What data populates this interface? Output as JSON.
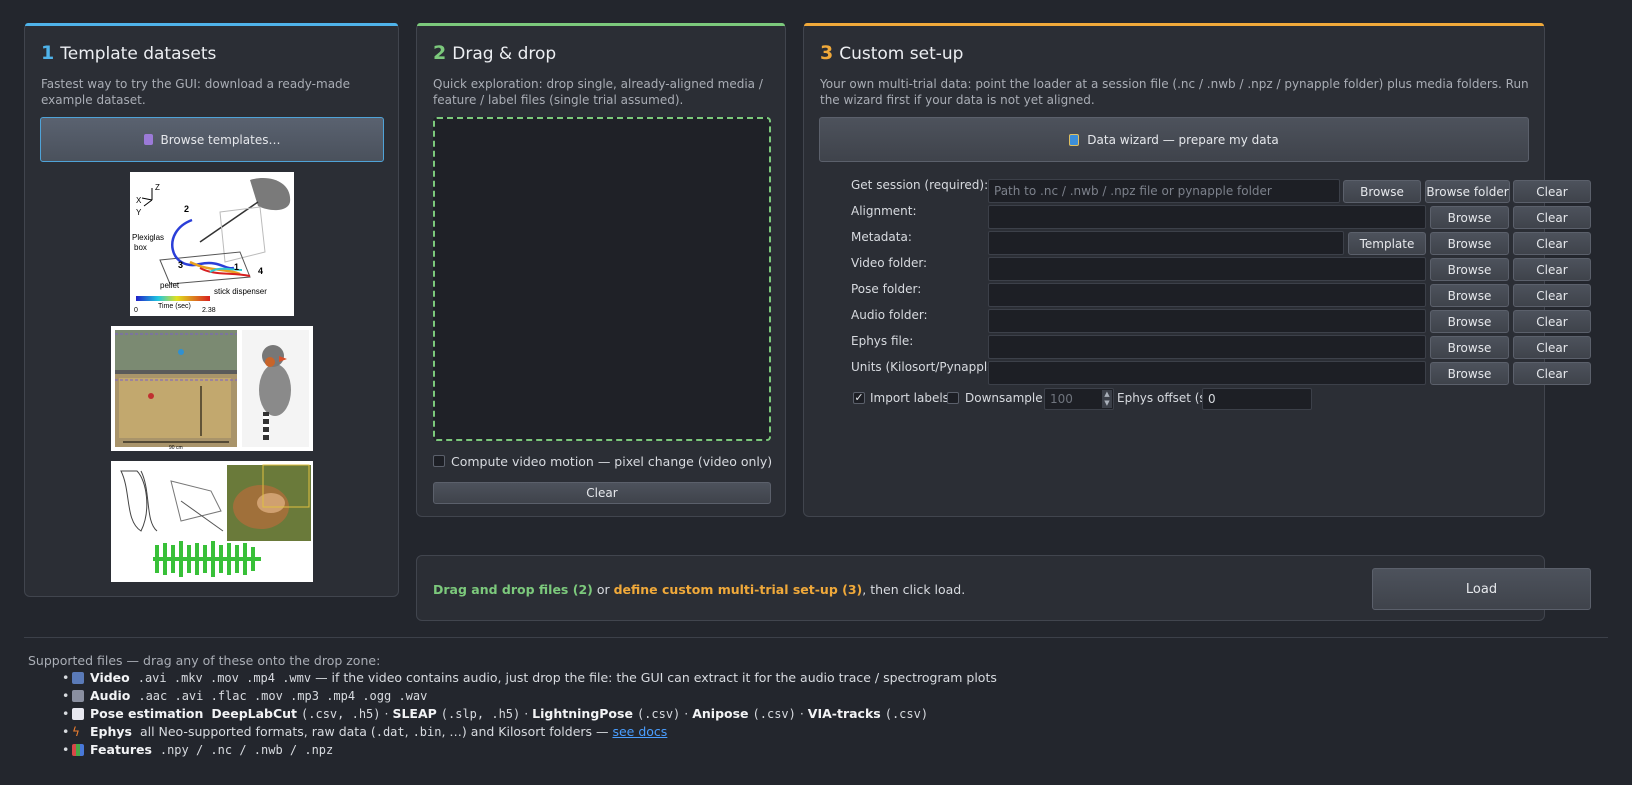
{
  "panel1": {
    "num": "1",
    "title": "Template datasets",
    "desc": "Fastest way to try the GUI: download a ready-made example dataset.",
    "browse_label": "Browse templates…",
    "thumb1": {
      "labels": [
        "Z",
        "X",
        "Y",
        "2",
        "Plexiglas",
        "box",
        "3",
        "1",
        "4",
        "pellet",
        "stick dispenser",
        "0",
        "Time (sec)",
        "2.38"
      ]
    },
    "thumb2": {
      "labels": [
        "90 cm"
      ]
    }
  },
  "panel2": {
    "num": "2",
    "title": "Drag & drop",
    "desc": "Quick exploration: drop single, already-aligned media / feature / label files (single trial assumed).",
    "motion_label": "Compute video motion — pixel change  (video only)",
    "clear_label": "Clear"
  },
  "panel3": {
    "num": "3",
    "title": "Custom set-up",
    "desc": "Your own multi-trial data: point the loader at a session file (.nc / .nwb / .npz / pynapple folder) plus media folders. Run the wizard first if your data is not yet aligned.",
    "wizard_label": "Data wizard — prepare my data",
    "rows": [
      {
        "label": "Get session (required):",
        "placeholder": "Path to .nc / .nwb / .npz file or pynapple folder"
      },
      {
        "label": "Alignment:",
        "placeholder": ""
      },
      {
        "label": "Metadata:",
        "placeholder": ""
      },
      {
        "label": "Video folder:",
        "placeholder": ""
      },
      {
        "label": "Pose folder:",
        "placeholder": ""
      },
      {
        "label": "Audio folder:",
        "placeholder": ""
      },
      {
        "label": "Ephys file:",
        "placeholder": ""
      },
      {
        "label": "Units (Kilosort/Pynapple):",
        "placeholder": ""
      }
    ],
    "browse": "Browse",
    "browse_folder": "Browse folder",
    "clear": "Clear",
    "template": "Template",
    "import_labels": "Import labels",
    "import_checked": "✓",
    "downsample": "Downsample:",
    "downsample_value": "100",
    "ephys_offset": "Ephys offset (s):",
    "ephys_offset_value": "0"
  },
  "loadbar": {
    "part1": "Drag and drop files (2)",
    "part2": " or ",
    "part3": "define custom multi-trial set-up (3)",
    "part4": ", then click load.",
    "load_label": "Load"
  },
  "supported": {
    "heading": "Supported files — drag any of these onto the drop zone:",
    "video": {
      "name": "Video",
      "exts": ".avi .mkv .mov .mp4 .wmv",
      "note": " — if the video contains audio, just drop the file: the GUI can extract it for the audio trace / spectrogram plots"
    },
    "audio": {
      "name": "Audio",
      "exts": ".aac .avi .flac .mov .mp3 .mp4 .ogg .wav"
    },
    "pose": {
      "name": "Pose estimation",
      "t1": "DeepLabCut",
      "e1": "(.csv, .h5)",
      "s1": " · ",
      "t2": "SLEAP",
      "e2": "(.slp, .h5)",
      "s2": " · ",
      "t3": "LightningPose",
      "e3": "(.csv)",
      "s3": " · ",
      "t4": "Anipose",
      "e4": "(.csv)",
      "s4": " · ",
      "t5": "VIA-tracks",
      "e5": "(.csv)"
    },
    "ephys": {
      "name": "Ephys",
      "text1": "all Neo-supported formats, raw data (",
      "ext1": ".dat",
      "text2": ", ",
      "ext2": ".bin",
      "text3": ", …) and Kilosort folders — ",
      "link": "see docs"
    },
    "features": {
      "name": "Features",
      "exts": ".npy / .nc / .nwb / .npz"
    }
  },
  "colors": {
    "accent1": "#4fb3ea",
    "accent2": "#7cc97c",
    "accent3": "#f0a93a",
    "link": "#4a9eff"
  }
}
